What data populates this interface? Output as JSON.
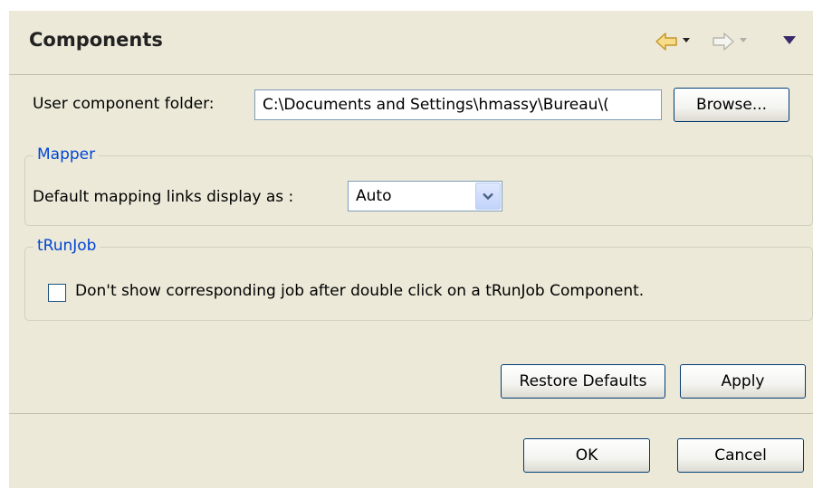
{
  "header": {
    "title": "Components",
    "back_icon": "back-arrow-icon",
    "forward_icon": "forward-arrow-icon",
    "menu_icon": "view-menu-icon",
    "back_color": "#e8b84a"
  },
  "user_folder": {
    "label": "User component folder:",
    "value": "C:\\Documents and Settings\\hmassy\\Bureau\\(",
    "browse_label": "Browse..."
  },
  "mapper": {
    "group_title": "Mapper",
    "label": "Default mapping links display as :",
    "selected": "Auto"
  },
  "trunjob": {
    "group_title": "tRunJob",
    "checkbox_label": "Don't show corresponding job after double click on a tRunJob Component.",
    "checked": false
  },
  "actions": {
    "restore_defaults": "Restore Defaults",
    "apply": "Apply"
  },
  "footer": {
    "ok": "OK",
    "cancel": "Cancel"
  },
  "colors": {
    "background": "#ece9d8",
    "group_title": "#0046d5",
    "button_border": "#003c74"
  }
}
